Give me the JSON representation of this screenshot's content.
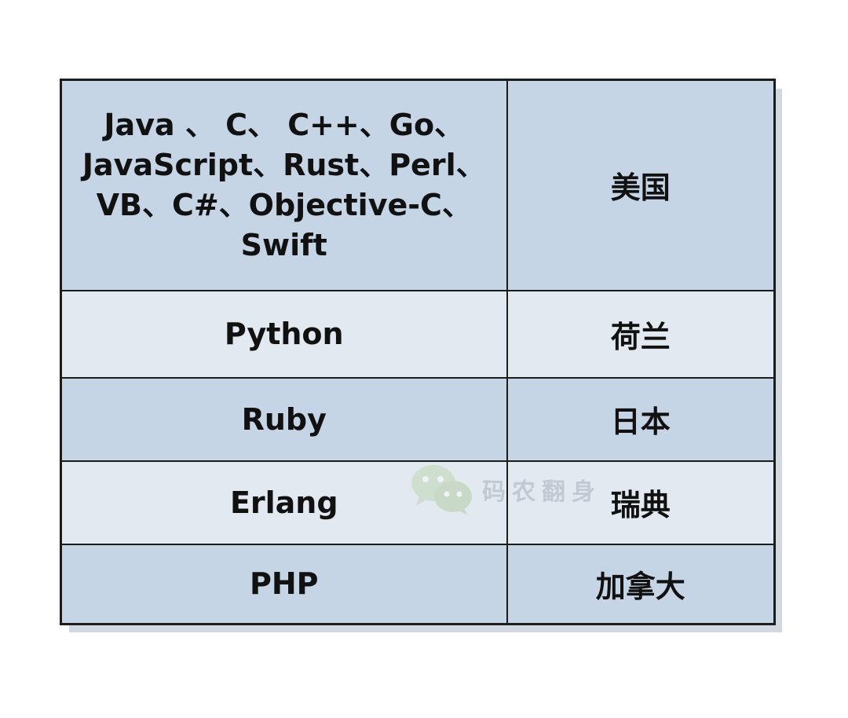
{
  "table": {
    "rows": [
      {
        "language": "Java 、 C、 C++、Go、JavaScript、Rust、Perl、VB、C#、Objective-C、Swift",
        "country": "美国"
      },
      {
        "language": "Python",
        "country": "荷兰"
      },
      {
        "language": "Ruby",
        "country": "日本"
      },
      {
        "language": "Erlang",
        "country": "瑞典"
      },
      {
        "language": "PHP",
        "country": "加拿大"
      }
    ]
  },
  "watermark": {
    "text": "码农翻身",
    "icon": "wechat-icon"
  }
}
